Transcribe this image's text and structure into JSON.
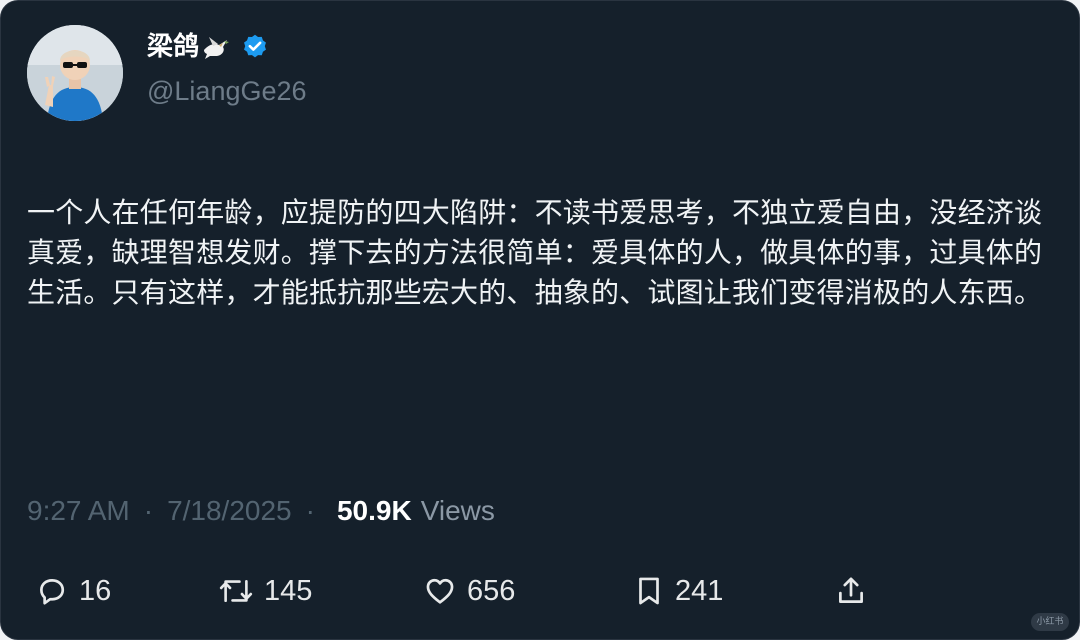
{
  "author": {
    "display_name": "梁鸽",
    "handle": "@LiangGe26",
    "verified": true,
    "name_emoji": "dove",
    "avatar": "profile-photo"
  },
  "tweet": {
    "text": "一个人在任何年龄，应提防的四大陷阱：不读书爱思考，不独立爱自由，没经济谈真爱，缺理智想发财。撑下去的方法很简单：爱具体的人，做具体的事，过具体的生活。只有这样，才能抵抗那些宏大的、抽象的、试图让我们变得消极的人东西。"
  },
  "meta": {
    "time": "9:27 AM",
    "separator": "·",
    "date": "7/18/2025",
    "views_count": "50.9K",
    "views_label": "Views"
  },
  "actions": {
    "replies": "16",
    "retweets": "145",
    "likes": "656",
    "bookmarks": "241"
  },
  "watermark": "小红书",
  "colors": {
    "background": "#15202b",
    "text": "#f0f3f5",
    "muted": "#536471",
    "verified": "#1d9bf0"
  }
}
